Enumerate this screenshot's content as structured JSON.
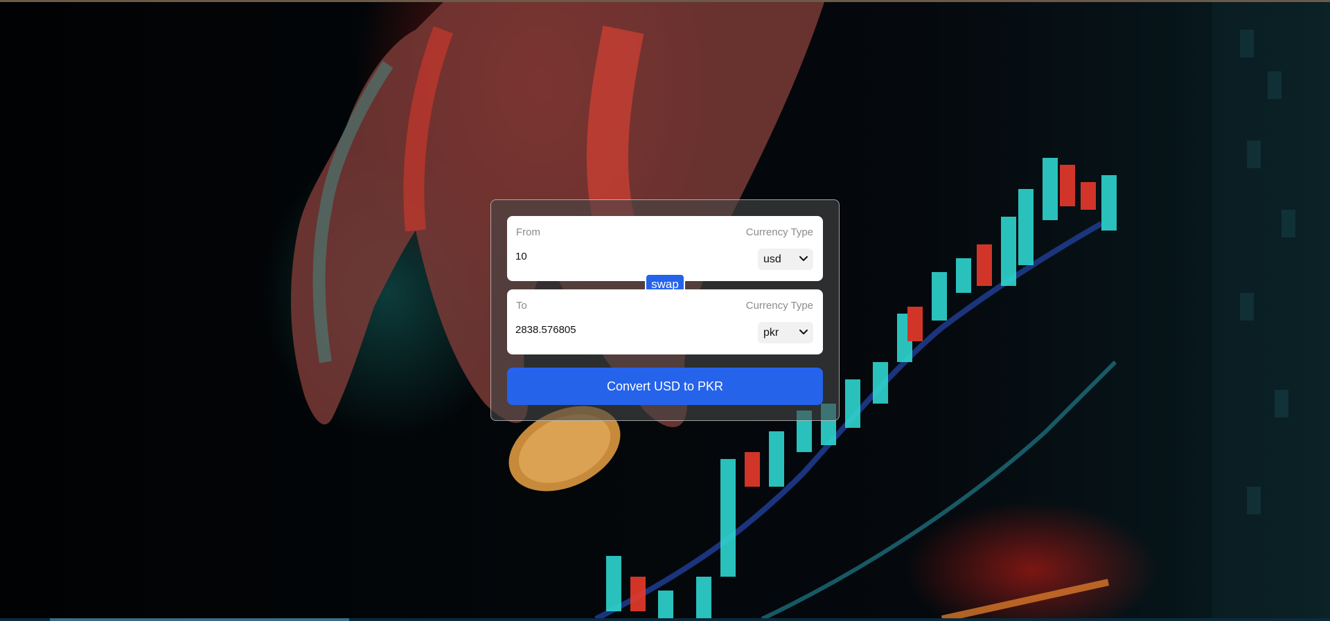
{
  "colors": {
    "primary": "#2563eb",
    "card_bg": "rgba(70,70,70,0.62)",
    "panel_bg": "#ffffff",
    "label": "#8b8b8b"
  },
  "from": {
    "label": "From",
    "currency_type_label": "Currency Type",
    "amount": "10",
    "currency": "usd"
  },
  "to": {
    "label": "To",
    "currency_type_label": "Currency Type",
    "amount": "2838.576805",
    "currency": "pkr"
  },
  "swap_label": "swap",
  "convert_label": "Convert USD to PKR",
  "icons": {
    "dropdown": "chevron-down-icon"
  }
}
